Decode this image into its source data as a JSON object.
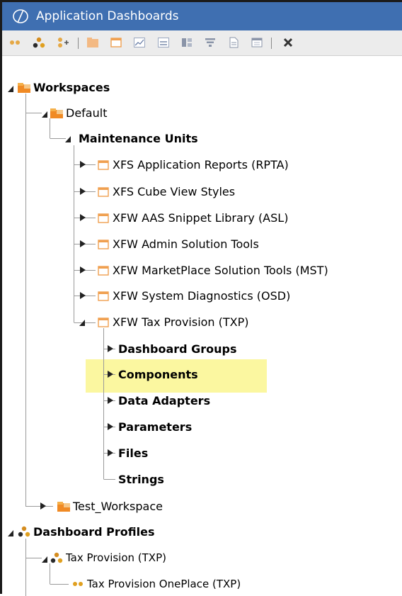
{
  "window": {
    "title": "Application Dashboards"
  },
  "toolbar": {
    "icons": [
      "dots-icon",
      "group-icon",
      "add-group-icon",
      "workspace-icon",
      "maintenance-unit-icon",
      "chart-icon",
      "form-icon",
      "layout-icon",
      "filter-icon",
      "file-icon",
      "calendar-icon",
      "delete-icon"
    ]
  },
  "tree": {
    "workspaces": "Workspaces",
    "default": "Default",
    "maintenance_units": "Maintenance Units",
    "units": [
      "XFS Application Reports (RPTA)",
      "XFS Cube View Styles",
      "XFW AAS Snippet Library (ASL)",
      "XFW Admin Solution Tools",
      "XFW MarketPlace Solution Tools (MST)",
      "XFW System Diagnostics (OSD)",
      "XFW Tax Provision (TXP)"
    ],
    "txp_children": [
      "Dashboard Groups",
      "Components",
      "Data Adapters",
      "Parameters",
      "Files",
      "Strings"
    ],
    "test_workspace": "Test_Workspace",
    "dashboard_profiles": "Dashboard Profiles",
    "tax_provision": "Tax Provision (TXP)",
    "tax_provision_oneplace": "Tax Provision OnePlace (TXP)"
  },
  "colors": {
    "titlebar": "#3f6fb1",
    "highlight": "#fbf7a0",
    "folder": "#f08a24",
    "profile": "#e0a020"
  }
}
